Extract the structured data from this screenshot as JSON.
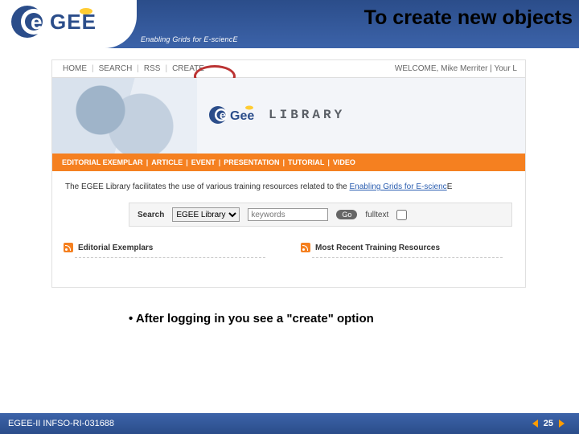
{
  "header": {
    "title": "To create new objects",
    "tagline": "Enabling Grids for E-sciencE"
  },
  "shot": {
    "topnav": {
      "home": "HOME",
      "search": "SEARCH",
      "rss": "RSS",
      "create": "CREATE"
    },
    "welcome_label": "WELCOME,",
    "welcome_user": "Mike Merriter",
    "welcome_trail": "| Your L",
    "library_word": "LIBRARY",
    "tabs": {
      "editorial": "EDITORIAL EXEMPLAR",
      "article": "ARTICLE",
      "event": "EVENT",
      "presentation": "PRESENTATION",
      "tutorial": "TUTORIAL",
      "video": "VIDEO"
    },
    "intro_prefix": "The EGEE Library facilitates the use of various training resources related to the ",
    "intro_link": "Enabling Grids for E-scienc",
    "intro_suffix": "E",
    "search": {
      "label": "Search",
      "scope": "EGEE Library",
      "keywords_placeholder": "keywords",
      "go": "Go",
      "fulltext_label": "fulltext"
    },
    "left_heading": "Editorial Exemplars",
    "right_heading": "Most Recent Training Resources"
  },
  "bullet": "• After logging in you see a \"create\" option",
  "footer": {
    "left": "EGEE-II INFSO-RI-031688",
    "page": "25"
  }
}
